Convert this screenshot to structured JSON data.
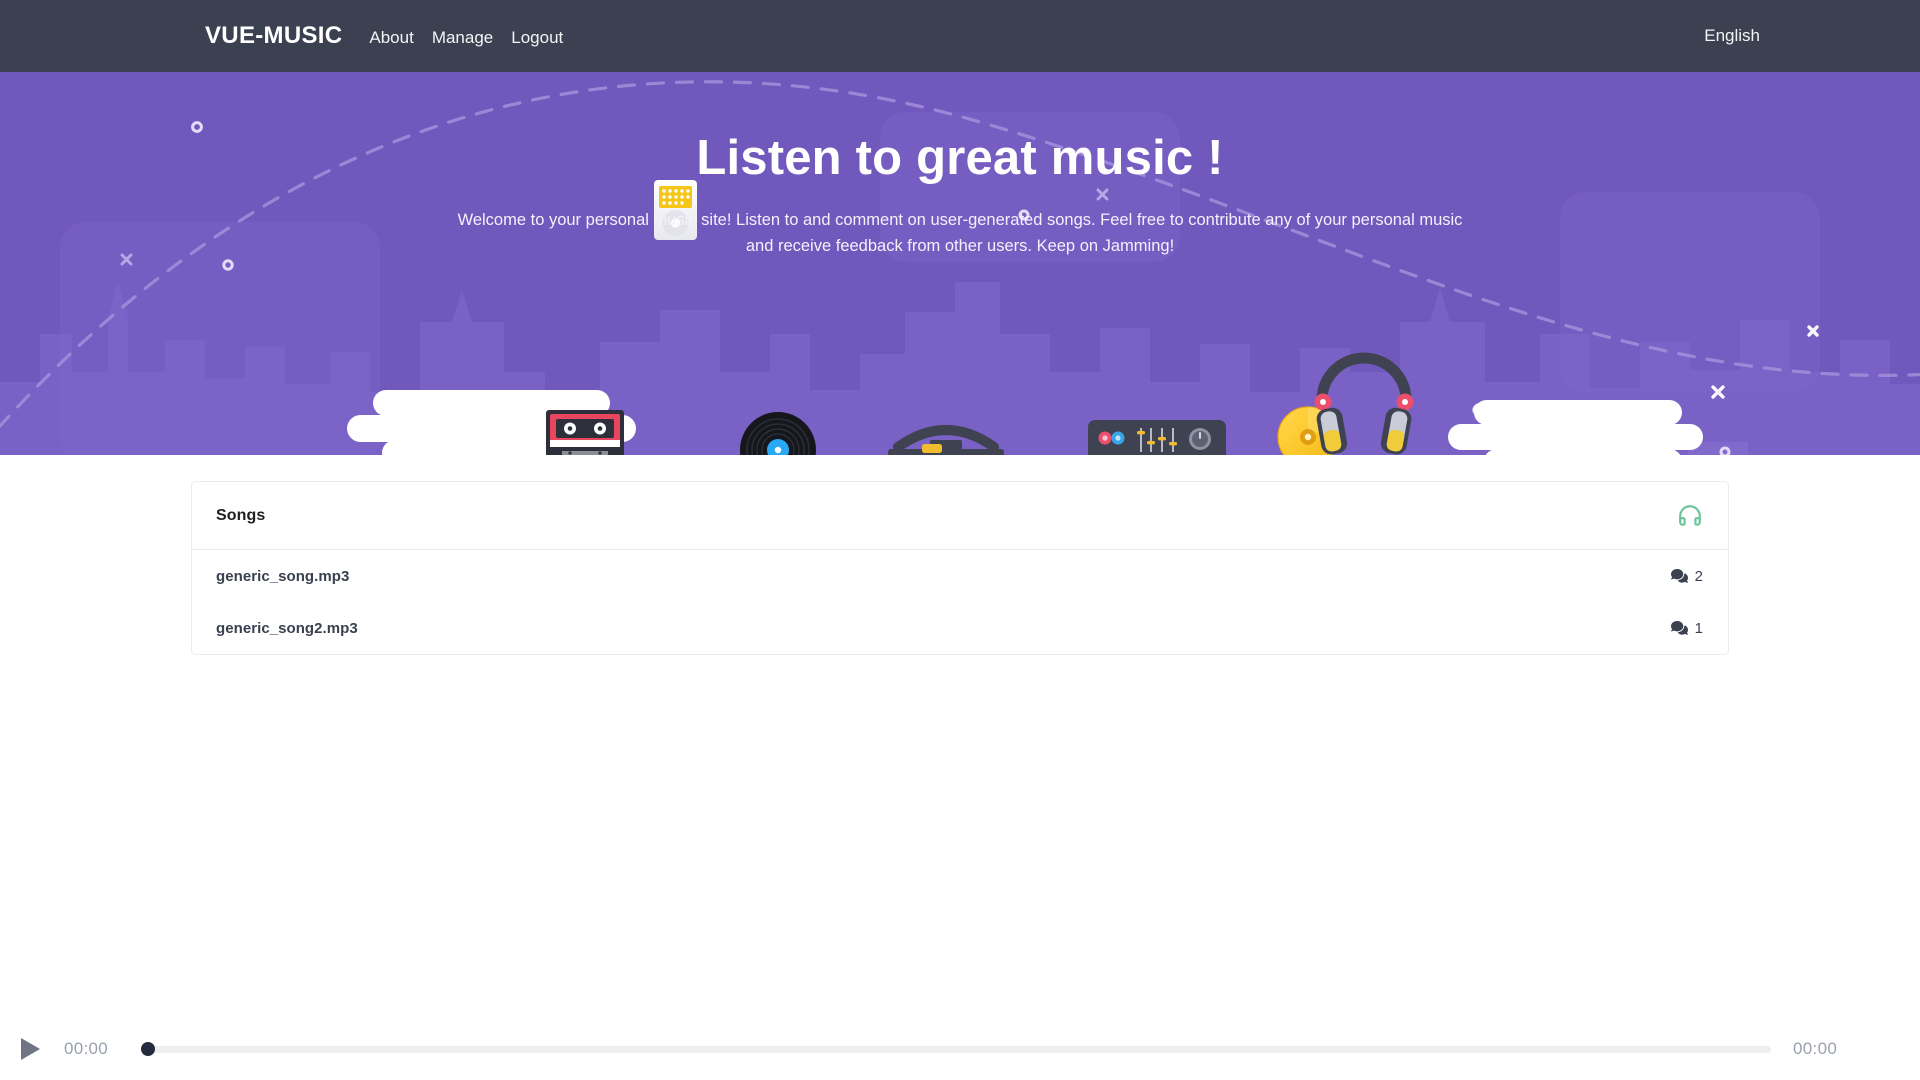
{
  "navbar": {
    "brand": "VUE-MUSIC",
    "links": [
      {
        "label": "About",
        "name": "nav-link-about"
      },
      {
        "label": "Manage",
        "name": "nav-link-manage"
      },
      {
        "label": "Logout",
        "name": "nav-link-logout"
      }
    ],
    "language": "English",
    "background_color": "#3c4151"
  },
  "hero": {
    "title": "Listen to great music !",
    "subtitle": "Welcome to your personal music site! Listen to and comment on user-generated songs. Feel free to contribute any of your personal music and receive feedback from other users. Keep on Jamming!",
    "background_color": "#7158bd",
    "illustration_items": [
      "cloud",
      "cassette-tape",
      "ipod",
      "vinyl-record",
      "boombox",
      "keyboard-synth",
      "headphones",
      "gold-cd",
      "cloud",
      "city-skyline"
    ]
  },
  "songs_card": {
    "title": "Songs",
    "header_icon": "headphones-icon",
    "header_icon_color": "#6cc49a",
    "rows": [
      {
        "name": "generic_song.mp3",
        "comment_icon": "comments-icon",
        "comment_count": "2"
      },
      {
        "name": "generic_song2.mp3",
        "comment_icon": "comments-icon",
        "comment_count": "1"
      }
    ]
  },
  "player": {
    "play_icon": "play-icon",
    "current_time": "00:00",
    "total_time": "00:00",
    "progress_percent": 0,
    "knob_color": "#242b3d",
    "track_color": "#eceef0"
  }
}
